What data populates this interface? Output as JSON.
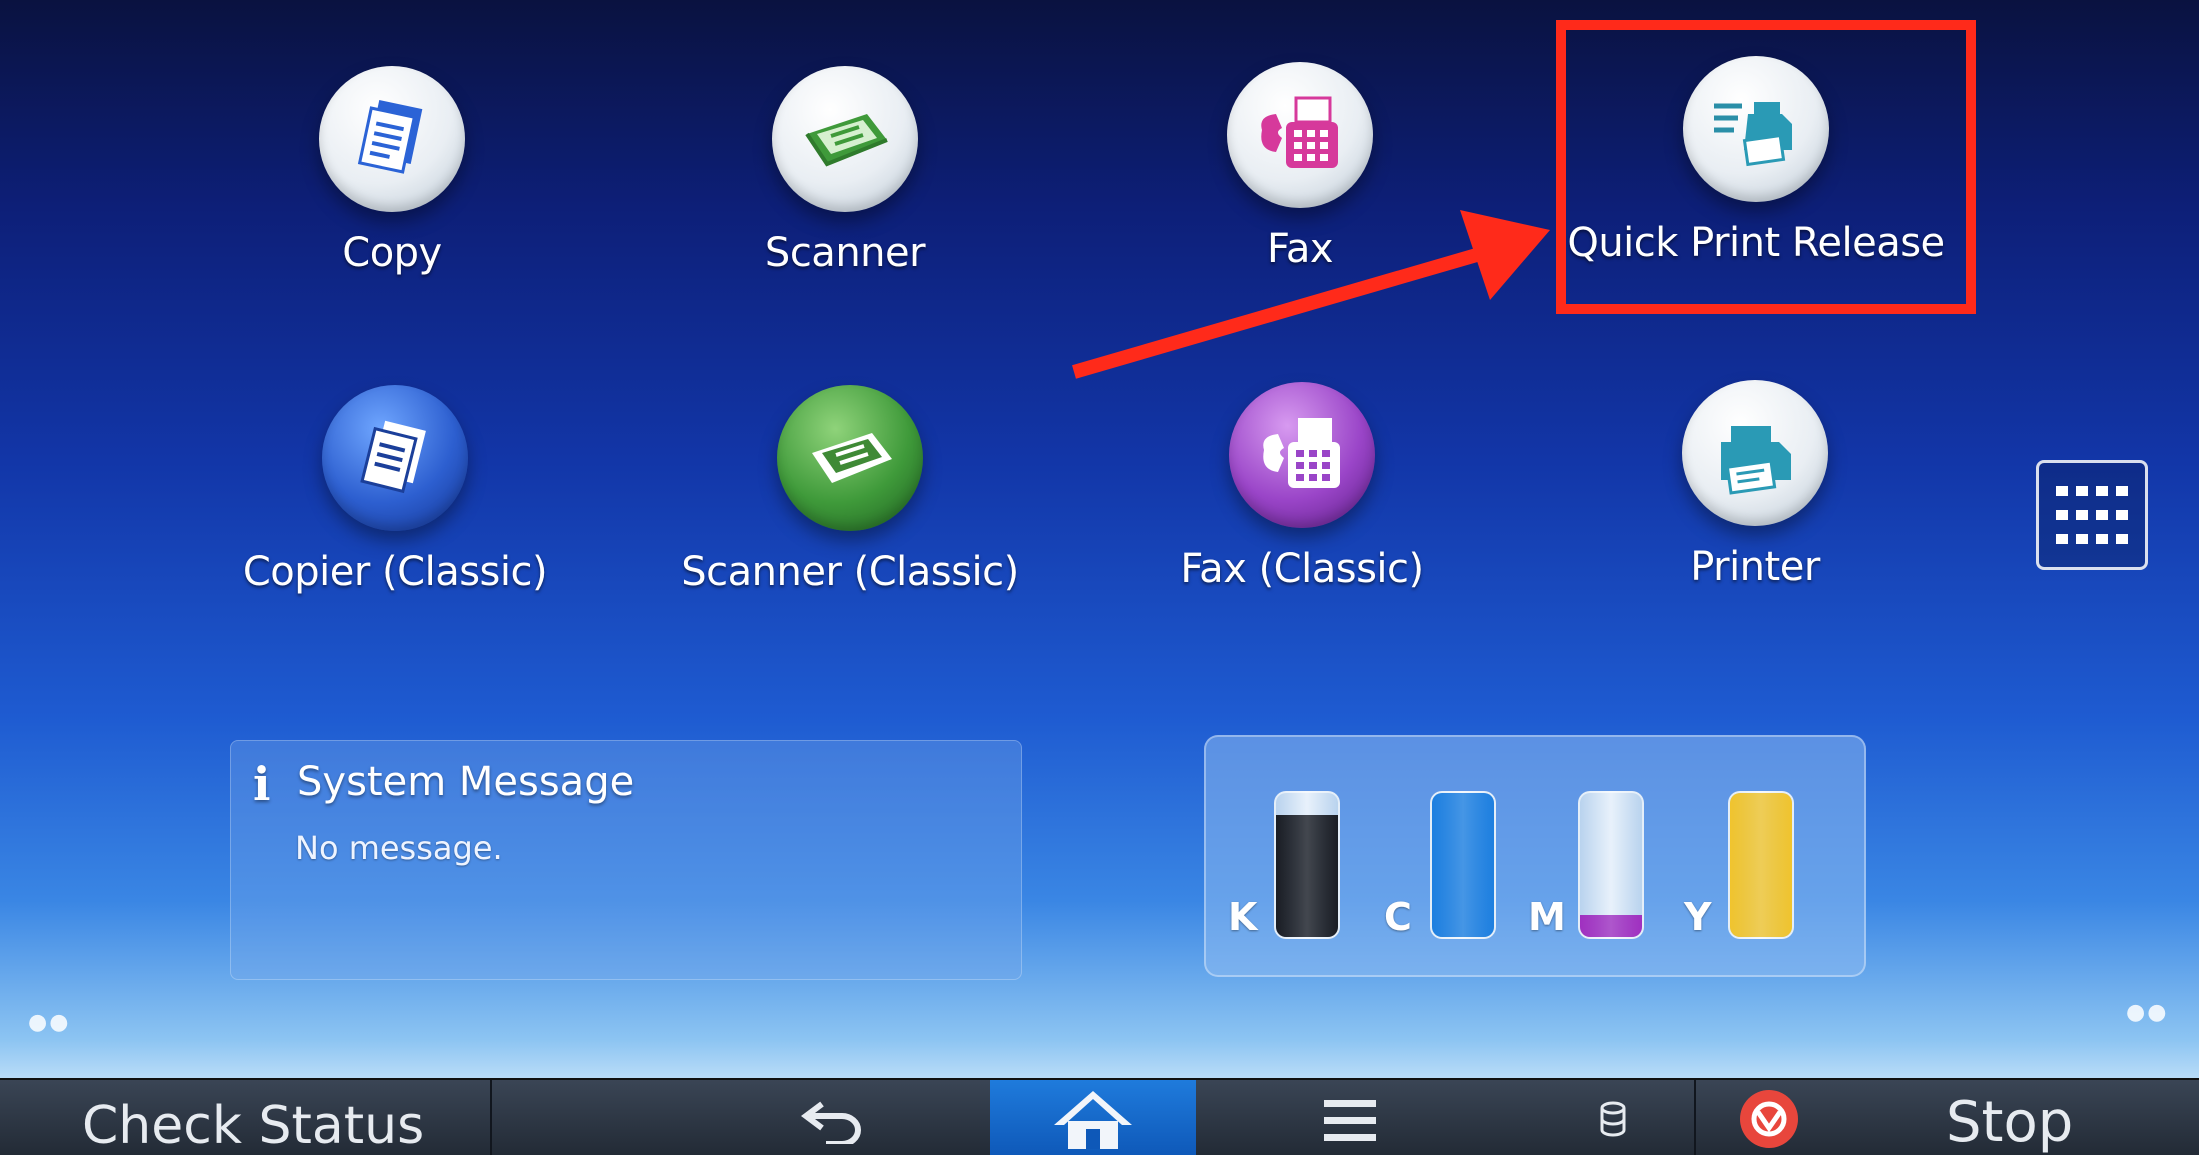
{
  "apps": [
    {
      "id": "copy",
      "label": "Copy",
      "icon": "copy-icon"
    },
    {
      "id": "scanner",
      "label": "Scanner",
      "icon": "scanner-icon"
    },
    {
      "id": "fax",
      "label": "Fax",
      "icon": "fax-icon"
    },
    {
      "id": "quick-print-release",
      "label": "Quick Print Release",
      "icon": "quick-print-icon"
    },
    {
      "id": "copier-classic",
      "label": "Copier (Classic)",
      "icon": "copier-classic-icon"
    },
    {
      "id": "scanner-classic",
      "label": "Scanner (Classic)",
      "icon": "scanner-classic-icon"
    },
    {
      "id": "fax-classic",
      "label": "Fax (Classic)",
      "icon": "fax-classic-icon"
    },
    {
      "id": "printer",
      "label": "Printer",
      "icon": "printer-icon"
    }
  ],
  "system_message": {
    "title": "System Message",
    "body": "No message."
  },
  "toner": [
    {
      "letter": "K",
      "level": 0.85,
      "color": "#1a1d24"
    },
    {
      "letter": "C",
      "level": 1.0,
      "color": "#1d7fe0"
    },
    {
      "letter": "M",
      "level": 0.15,
      "color": "#a030c0"
    },
    {
      "letter": "Y",
      "level": 1.0,
      "color": "#f0c42e"
    }
  ],
  "footer": {
    "check_status": "Check Status",
    "stop": "Stop"
  },
  "colors": {
    "highlight": "#ff2a1a",
    "home_button": "#1a6fd0"
  }
}
